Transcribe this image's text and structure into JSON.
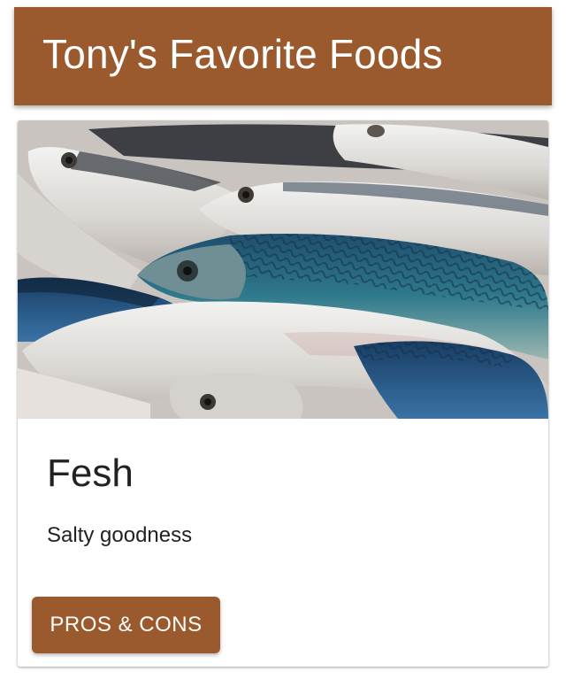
{
  "app_bar": {
    "title": "Tony's Favorite Foods",
    "color": "#9a5a2e"
  },
  "card": {
    "image_alt": "Fresh mackerel fish",
    "title": "Fesh",
    "description": "Salty goodness",
    "action_label": "PROS & CONS",
    "action_color": "#9a5a2e"
  }
}
